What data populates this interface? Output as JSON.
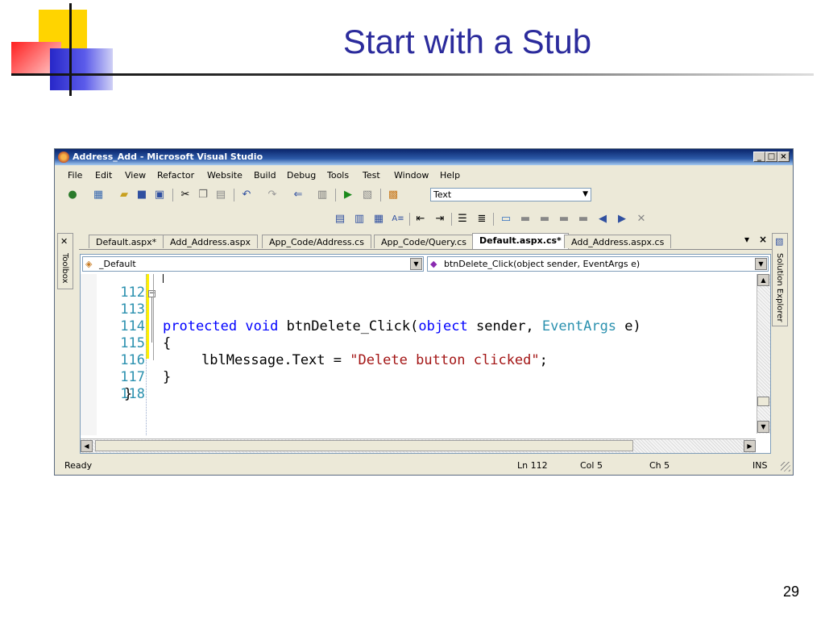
{
  "slide": {
    "title": "Start with a Stub",
    "page_number": "29"
  },
  "window": {
    "title": "Address_Add - Microsoft Visual Studio"
  },
  "menu": [
    "File",
    "Edit",
    "View",
    "Refactor",
    "Website",
    "Build",
    "Debug",
    "Tools",
    "Test",
    "Window",
    "Help"
  ],
  "toolbar": {
    "target_combo": "Text"
  },
  "tabs": [
    {
      "label": "Default.aspx*",
      "active": false
    },
    {
      "label": "Add_Address.aspx",
      "active": false
    },
    {
      "label": "App_Code/Address.cs",
      "active": false
    },
    {
      "label": "App_Code/Query.cs",
      "active": false
    },
    {
      "label": "Default.aspx.cs*",
      "active": true
    },
    {
      "label": "Add_Address.aspx.cs",
      "active": false
    }
  ],
  "side_panels": {
    "left": "Toolbox",
    "right": "Solution Explorer"
  },
  "editor": {
    "class_combo": "_Default",
    "member_combo": "btnDelete_Click(object sender, EventArgs e)",
    "lines": [
      {
        "number": "112"
      },
      {
        "number": "113",
        "text": "protected void btnDelete_Click(object sender, EventArgs e)"
      },
      {
        "number": "114",
        "text": "{"
      },
      {
        "number": "115",
        "text": "lblMessage.Text = \"Delete button clicked\";"
      },
      {
        "number": "116",
        "text": "}"
      },
      {
        "number": "117",
        "text": "}"
      },
      {
        "number": "118"
      }
    ],
    "tokens": {
      "kw_protected": "protected",
      "kw_void": "void",
      "method": "btnDelete_Click(",
      "kw_object": "object",
      "param1": "sender,",
      "type_eventargs": "EventArgs",
      "param2": "e)",
      "assign": "lblMessage.Text = ",
      "string": "\"Delete button clicked\"",
      "semicolon": ";"
    }
  },
  "status": {
    "state": "Ready",
    "line": "Ln 112",
    "col": "Col 5",
    "ch": "Ch 5",
    "mode": "INS"
  },
  "colors": {
    "keyword": "#0000ff",
    "type": "#2b91af",
    "string": "#a31515",
    "title": "#2b2b9c"
  }
}
